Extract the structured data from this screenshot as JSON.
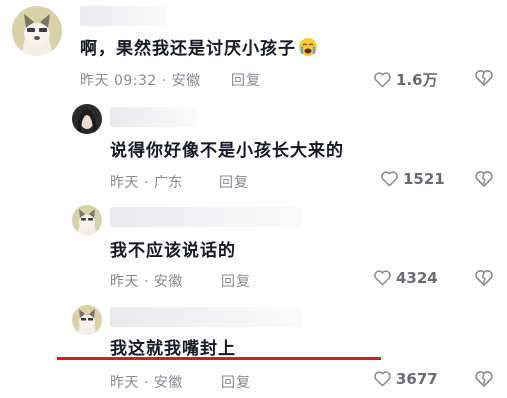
{
  "comments": [
    {
      "level": "top",
      "text": "啊，果然我还是讨厌小孩子",
      "emoji": "crying-emoji",
      "meta": "昨天 09:32 · 安徽",
      "reply_label": "回复",
      "likes": "1.6万"
    },
    {
      "level": "reply",
      "text": "说得你好像不是小孩长大来的",
      "meta": "昨天 · 广东",
      "reply_label": "回复",
      "likes": "1521"
    },
    {
      "level": "reply",
      "text": "我不应该说话的",
      "meta": "昨天 · 安徽",
      "reply_label": "回复",
      "likes": "4324"
    },
    {
      "level": "reply",
      "text": "我这就我嘴封上",
      "meta": "昨天 · 安徽",
      "reply_label": "回复",
      "likes": "3677"
    }
  ],
  "colors": {
    "accent_underline": "#e0171c",
    "meta_text": "#8a8b91"
  }
}
